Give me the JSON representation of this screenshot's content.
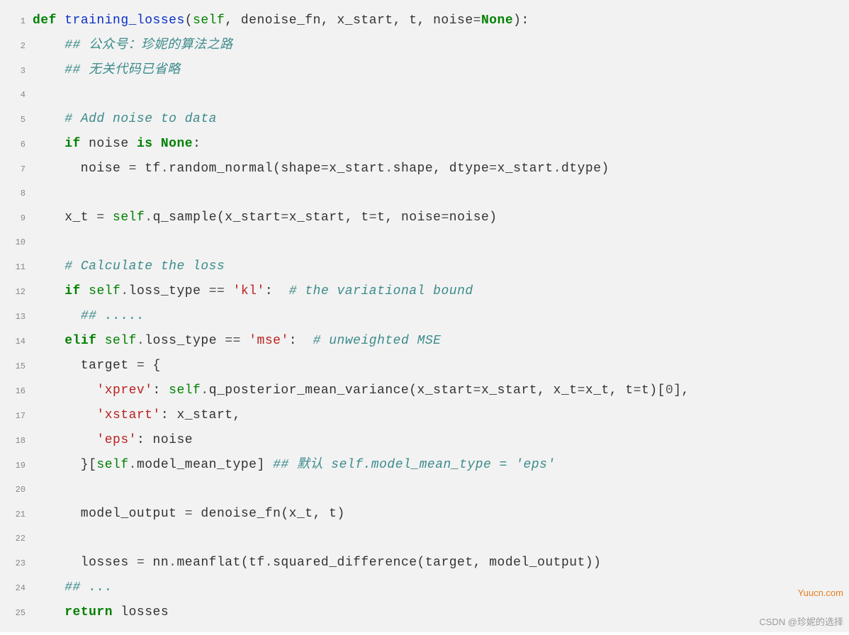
{
  "watermark_right": "Yuucn.com",
  "watermark_bottom": "CSDN @珍妮的选择",
  "lines": [
    {
      "n": "1",
      "tokens": [
        {
          "cls": "kw",
          "t": "def"
        },
        {
          "cls": "id",
          "t": " "
        },
        {
          "cls": "fn",
          "t": "training_losses"
        },
        {
          "cls": "id",
          "t": "("
        },
        {
          "cls": "self",
          "t": "self"
        },
        {
          "cls": "id",
          "t": ", denoise_fn, x_start, t, noise"
        },
        {
          "cls": "op",
          "t": "="
        },
        {
          "cls": "none",
          "t": "None"
        },
        {
          "cls": "id",
          "t": "):"
        }
      ]
    },
    {
      "n": "2",
      "tokens": [
        {
          "cls": "id",
          "t": "    "
        },
        {
          "cls": "cmt",
          "t": "## 公众号：珍妮的算法之路"
        }
      ]
    },
    {
      "n": "3",
      "tokens": [
        {
          "cls": "id",
          "t": "    "
        },
        {
          "cls": "cmt",
          "t": "## 无关代码已省略"
        }
      ]
    },
    {
      "n": "4",
      "tokens": [
        {
          "cls": "id",
          "t": ""
        }
      ]
    },
    {
      "n": "5",
      "tokens": [
        {
          "cls": "id",
          "t": "    "
        },
        {
          "cls": "cmt",
          "t": "# Add noise to data"
        }
      ]
    },
    {
      "n": "6",
      "tokens": [
        {
          "cls": "id",
          "t": "    "
        },
        {
          "cls": "kw",
          "t": "if"
        },
        {
          "cls": "id",
          "t": " noise "
        },
        {
          "cls": "kw",
          "t": "is"
        },
        {
          "cls": "id",
          "t": " "
        },
        {
          "cls": "none",
          "t": "None"
        },
        {
          "cls": "id",
          "t": ":"
        }
      ]
    },
    {
      "n": "7",
      "tokens": [
        {
          "cls": "id",
          "t": "      noise "
        },
        {
          "cls": "op",
          "t": "="
        },
        {
          "cls": "id",
          "t": " tf"
        },
        {
          "cls": "op",
          "t": "."
        },
        {
          "cls": "id",
          "t": "random_normal(shape"
        },
        {
          "cls": "op",
          "t": "="
        },
        {
          "cls": "id",
          "t": "x_start"
        },
        {
          "cls": "op",
          "t": "."
        },
        {
          "cls": "id",
          "t": "shape, dtype"
        },
        {
          "cls": "op",
          "t": "="
        },
        {
          "cls": "id",
          "t": "x_start"
        },
        {
          "cls": "op",
          "t": "."
        },
        {
          "cls": "id",
          "t": "dtype)"
        }
      ]
    },
    {
      "n": "8",
      "tokens": [
        {
          "cls": "id",
          "t": ""
        }
      ]
    },
    {
      "n": "9",
      "tokens": [
        {
          "cls": "id",
          "t": "    x_t "
        },
        {
          "cls": "op",
          "t": "="
        },
        {
          "cls": "id",
          "t": " "
        },
        {
          "cls": "self",
          "t": "self"
        },
        {
          "cls": "op",
          "t": "."
        },
        {
          "cls": "id",
          "t": "q_sample(x_start"
        },
        {
          "cls": "op",
          "t": "="
        },
        {
          "cls": "id",
          "t": "x_start, t"
        },
        {
          "cls": "op",
          "t": "="
        },
        {
          "cls": "id",
          "t": "t, noise"
        },
        {
          "cls": "op",
          "t": "="
        },
        {
          "cls": "id",
          "t": "noise)"
        }
      ]
    },
    {
      "n": "10",
      "tokens": [
        {
          "cls": "id",
          "t": ""
        }
      ]
    },
    {
      "n": "11",
      "tokens": [
        {
          "cls": "id",
          "t": "    "
        },
        {
          "cls": "cmt",
          "t": "# Calculate the loss"
        }
      ]
    },
    {
      "n": "12",
      "tokens": [
        {
          "cls": "id",
          "t": "    "
        },
        {
          "cls": "kw",
          "t": "if"
        },
        {
          "cls": "id",
          "t": " "
        },
        {
          "cls": "self",
          "t": "self"
        },
        {
          "cls": "op",
          "t": "."
        },
        {
          "cls": "id",
          "t": "loss_type "
        },
        {
          "cls": "op",
          "t": "=="
        },
        {
          "cls": "id",
          "t": " "
        },
        {
          "cls": "str",
          "t": "'kl'"
        },
        {
          "cls": "id",
          "t": ":  "
        },
        {
          "cls": "cmt",
          "t": "# the variational bound"
        }
      ]
    },
    {
      "n": "13",
      "tokens": [
        {
          "cls": "id",
          "t": "      "
        },
        {
          "cls": "cmt",
          "t": "## ....."
        }
      ]
    },
    {
      "n": "14",
      "tokens": [
        {
          "cls": "id",
          "t": "    "
        },
        {
          "cls": "kw",
          "t": "elif"
        },
        {
          "cls": "id",
          "t": " "
        },
        {
          "cls": "self",
          "t": "self"
        },
        {
          "cls": "op",
          "t": "."
        },
        {
          "cls": "id",
          "t": "loss_type "
        },
        {
          "cls": "op",
          "t": "=="
        },
        {
          "cls": "id",
          "t": " "
        },
        {
          "cls": "str",
          "t": "'mse'"
        },
        {
          "cls": "id",
          "t": ":  "
        },
        {
          "cls": "cmt",
          "t": "# unweighted MSE"
        }
      ]
    },
    {
      "n": "15",
      "tokens": [
        {
          "cls": "id",
          "t": "      target "
        },
        {
          "cls": "op",
          "t": "="
        },
        {
          "cls": "id",
          "t": " {"
        }
      ]
    },
    {
      "n": "16",
      "tokens": [
        {
          "cls": "id",
          "t": "        "
        },
        {
          "cls": "str",
          "t": "'xprev'"
        },
        {
          "cls": "id",
          "t": ": "
        },
        {
          "cls": "self",
          "t": "self"
        },
        {
          "cls": "op",
          "t": "."
        },
        {
          "cls": "id",
          "t": "q_posterior_mean_variance(x_start"
        },
        {
          "cls": "op",
          "t": "="
        },
        {
          "cls": "id",
          "t": "x_start, x_t"
        },
        {
          "cls": "op",
          "t": "="
        },
        {
          "cls": "id",
          "t": "x_t, t"
        },
        {
          "cls": "op",
          "t": "="
        },
        {
          "cls": "id",
          "t": "t)["
        },
        {
          "cls": "num",
          "t": "0"
        },
        {
          "cls": "id",
          "t": "],"
        }
      ]
    },
    {
      "n": "17",
      "tokens": [
        {
          "cls": "id",
          "t": "        "
        },
        {
          "cls": "str",
          "t": "'xstart'"
        },
        {
          "cls": "id",
          "t": ": x_start,"
        }
      ]
    },
    {
      "n": "18",
      "tokens": [
        {
          "cls": "id",
          "t": "        "
        },
        {
          "cls": "str",
          "t": "'eps'"
        },
        {
          "cls": "id",
          "t": ": noise"
        }
      ]
    },
    {
      "n": "19",
      "tokens": [
        {
          "cls": "id",
          "t": "      }["
        },
        {
          "cls": "self",
          "t": "self"
        },
        {
          "cls": "op",
          "t": "."
        },
        {
          "cls": "id",
          "t": "model_mean_type] "
        },
        {
          "cls": "cmt",
          "t": "## 默认 self.model_mean_type = 'eps'"
        }
      ]
    },
    {
      "n": "20",
      "tokens": [
        {
          "cls": "id",
          "t": ""
        }
      ]
    },
    {
      "n": "21",
      "tokens": [
        {
          "cls": "id",
          "t": "      model_output "
        },
        {
          "cls": "op",
          "t": "="
        },
        {
          "cls": "id",
          "t": " denoise_fn(x_t, t)"
        }
      ]
    },
    {
      "n": "22",
      "tokens": [
        {
          "cls": "id",
          "t": ""
        }
      ]
    },
    {
      "n": "23",
      "tokens": [
        {
          "cls": "id",
          "t": "      losses "
        },
        {
          "cls": "op",
          "t": "="
        },
        {
          "cls": "id",
          "t": " nn"
        },
        {
          "cls": "op",
          "t": "."
        },
        {
          "cls": "id",
          "t": "meanflat(tf"
        },
        {
          "cls": "op",
          "t": "."
        },
        {
          "cls": "id",
          "t": "squared_difference(target, model_output))"
        }
      ]
    },
    {
      "n": "24",
      "tokens": [
        {
          "cls": "id",
          "t": "    "
        },
        {
          "cls": "cmt",
          "t": "## ..."
        }
      ]
    },
    {
      "n": "25",
      "tokens": [
        {
          "cls": "id",
          "t": "    "
        },
        {
          "cls": "kw",
          "t": "return"
        },
        {
          "cls": "id",
          "t": " losses"
        }
      ]
    }
  ]
}
